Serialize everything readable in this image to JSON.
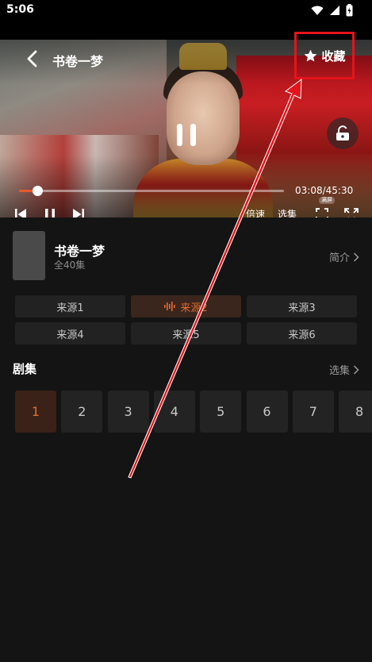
{
  "status_bar": {
    "time": "5:06"
  },
  "player": {
    "title": "书卷一梦",
    "collect_label": "收藏",
    "current_time": "03:08",
    "total_time": "45:30",
    "progress": 0.068,
    "speed_label": "倍速",
    "select_label": "选集",
    "fullscreen_badge": "满屏"
  },
  "info": {
    "title": "书卷一梦",
    "episode_count": "全40集",
    "intro_label": "简介"
  },
  "sources": [
    {
      "label": "来源1",
      "active": false
    },
    {
      "label": "来源2",
      "active": true
    },
    {
      "label": "来源3",
      "active": false
    },
    {
      "label": "来源4",
      "active": false
    },
    {
      "label": "来源5",
      "active": false
    },
    {
      "label": "来源6",
      "active": false
    }
  ],
  "episodes_section": {
    "title": "剧集",
    "select_label": "选集",
    "items": [
      "1",
      "2",
      "3",
      "4",
      "5",
      "6",
      "7",
      "8"
    ],
    "active_index": 0
  },
  "colors": {
    "accent": "#e8692e",
    "annotation_red": "#e5141b",
    "background": "#141414"
  }
}
